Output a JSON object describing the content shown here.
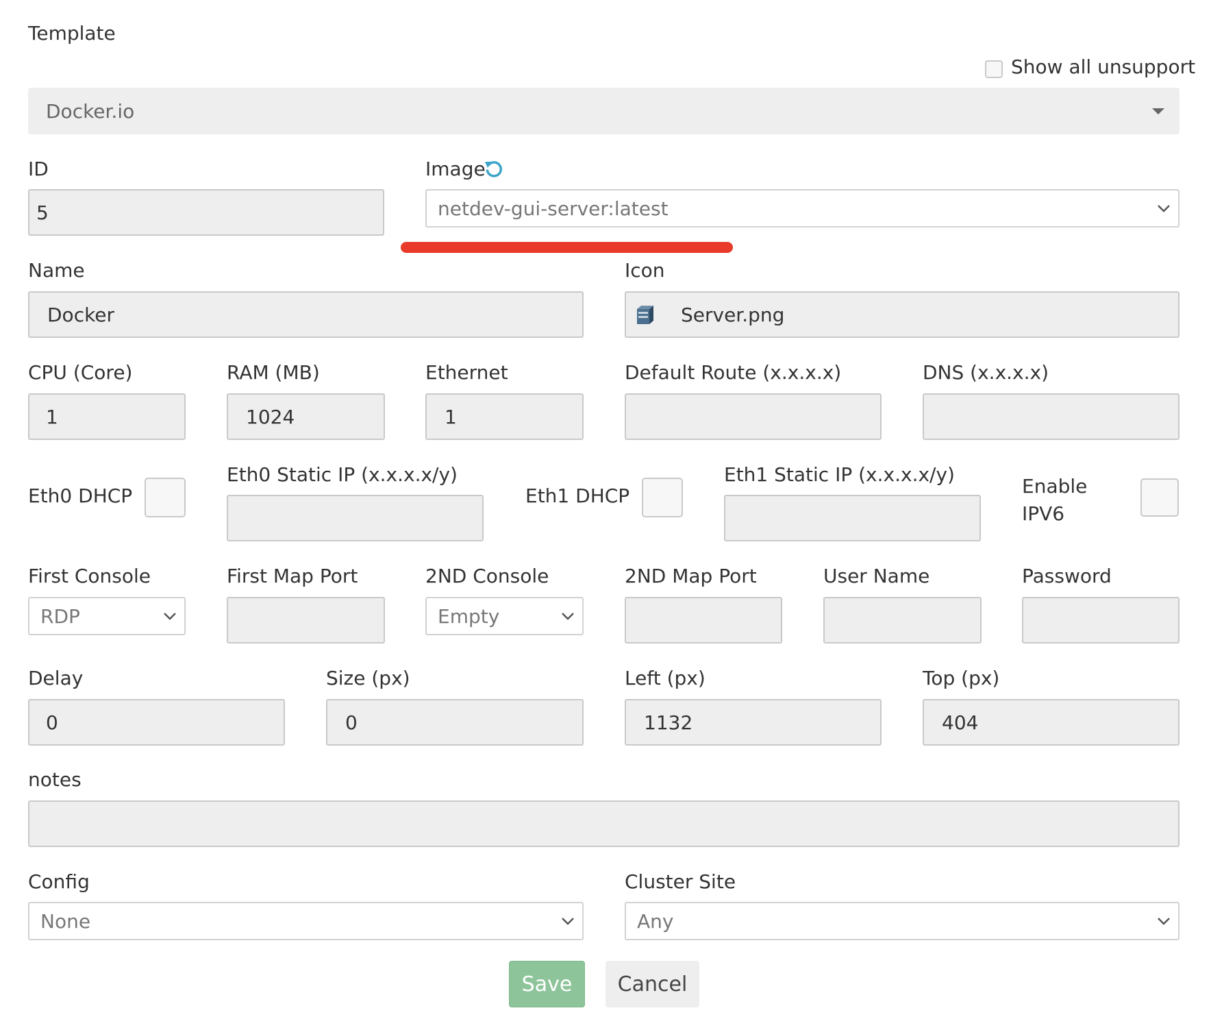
{
  "template": {
    "label": "Template",
    "show_unsupported_label": "Show all unsupport",
    "selected": "Docker.io"
  },
  "id": {
    "label": "ID",
    "value": "5"
  },
  "image": {
    "label": "Image",
    "selected": "netdev-gui-server:latest"
  },
  "name": {
    "label": "Name",
    "value": "Docker"
  },
  "icon": {
    "label": "Icon",
    "value": "Server.png"
  },
  "cpu": {
    "label": "CPU (Core)",
    "value": "1"
  },
  "ram": {
    "label": "RAM (MB)",
    "value": "1024"
  },
  "ethernet": {
    "label": "Ethernet",
    "value": "1"
  },
  "default_route": {
    "label": "Default Route (x.x.x.x)",
    "value": ""
  },
  "dns": {
    "label": "DNS (x.x.x.x)",
    "value": ""
  },
  "eth0_dhcp": {
    "label": "Eth0 DHCP"
  },
  "eth0_static": {
    "label": "Eth0 Static IP (x.x.x.x/y)",
    "value": ""
  },
  "eth1_dhcp": {
    "label": "Eth1 DHCP"
  },
  "eth1_static": {
    "label": "Eth1 Static IP (x.x.x.x/y)",
    "value": ""
  },
  "ipv6": {
    "label_line1": "Enable",
    "label_line2": "IPV6"
  },
  "first_console": {
    "label": "First Console",
    "selected": "RDP"
  },
  "first_map_port": {
    "label": "First Map Port",
    "value": ""
  },
  "second_console": {
    "label": "2ND Console",
    "selected": "Empty"
  },
  "second_map_port": {
    "label": "2ND Map Port",
    "value": ""
  },
  "username": {
    "label": "User Name",
    "value": ""
  },
  "password": {
    "label": "Password",
    "value": ""
  },
  "delay": {
    "label": "Delay",
    "value": "0"
  },
  "size": {
    "label": "Size (px)",
    "value": "0"
  },
  "left": {
    "label": "Left (px)",
    "value": "1132"
  },
  "top": {
    "label": "Top (px)",
    "value": "404"
  },
  "notes": {
    "label": "notes",
    "value": ""
  },
  "config": {
    "label": "Config",
    "selected": "None"
  },
  "cluster": {
    "label": "Cluster Site",
    "selected": "Any"
  },
  "actions": {
    "save": "Save",
    "cancel": "Cancel"
  },
  "colors": {
    "save_button": "#8dc49a",
    "cancel_button": "#eeeeee",
    "refresh_icon": "#3ba4c8",
    "annotation_underline": "#e8392a",
    "field_background": "#eeeeee"
  }
}
